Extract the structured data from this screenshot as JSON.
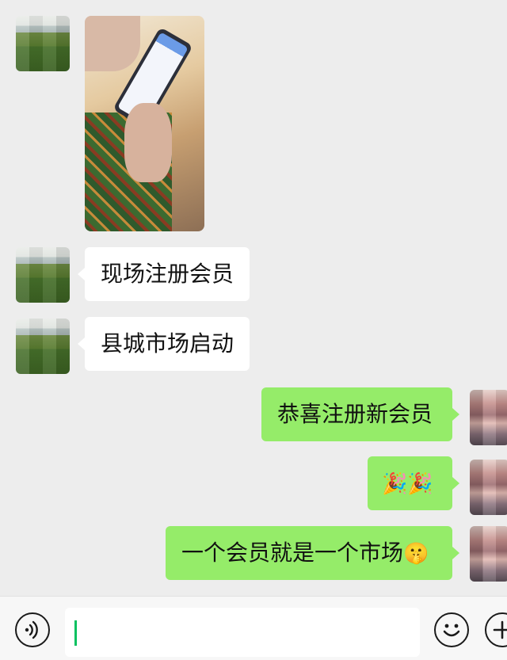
{
  "messages": [
    {
      "side": "left",
      "type": "image",
      "image_desc": "photo"
    },
    {
      "side": "left",
      "type": "text",
      "text": "现场注册会员"
    },
    {
      "side": "left",
      "type": "text",
      "text": "县城市场启动"
    },
    {
      "side": "right",
      "type": "text",
      "text": "恭喜注册新会员"
    },
    {
      "side": "right",
      "type": "emoji",
      "text": "🎉🎉"
    },
    {
      "side": "right",
      "type": "text",
      "text": "一个会员就是一个市场",
      "trailing_emoji": "🤫"
    }
  ],
  "input_bar": {
    "voice_icon": "voice-icon",
    "text_value": "",
    "emoji_icon": "smiley-icon",
    "more_icon": "plus-icon"
  },
  "colors": {
    "background": "#ededed",
    "incoming_bubble": "#ffffff",
    "outgoing_bubble": "#95ec69",
    "caret": "#07c160"
  }
}
